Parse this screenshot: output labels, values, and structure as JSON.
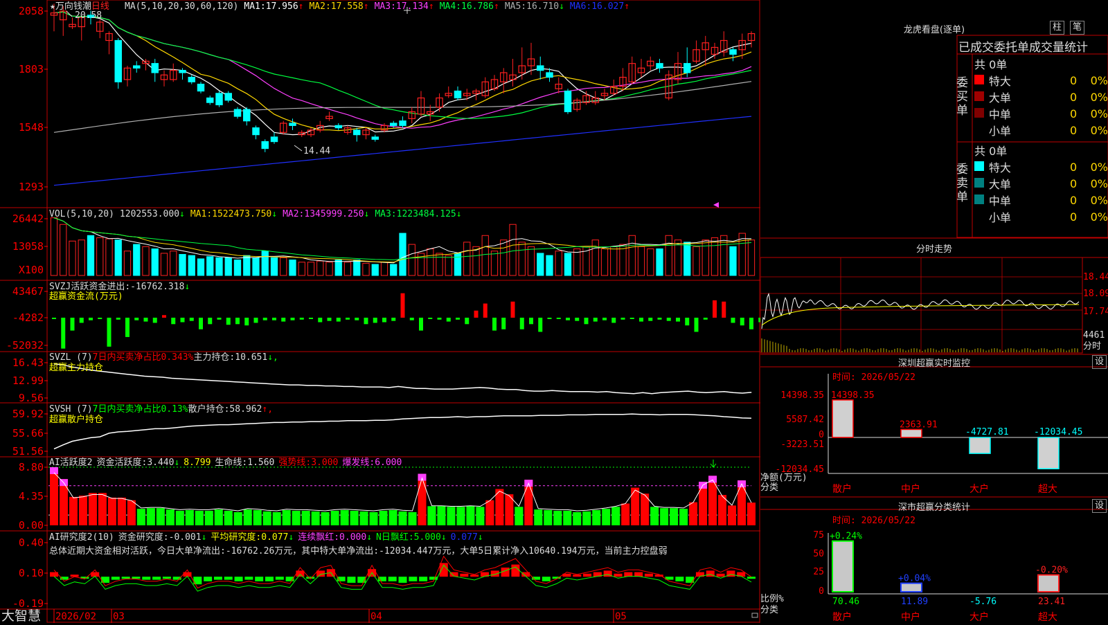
{
  "stock": {
    "name": "万向钱潮",
    "period": "日线",
    "star": "★"
  },
  "colors": {
    "up": "#ff2020",
    "down": "#00ffff",
    "ma1": "#ffffff",
    "ma2": "#ffd800",
    "ma3": "#ff40ff",
    "ma4": "#00ff40",
    "ma5": "#b0b0b0",
    "ma6": "#2030ff",
    "vol_bar": "#00ffff",
    "green": "#00ff00",
    "red": "#ff0000",
    "grid": "#c00000",
    "yellow": "#ffff00"
  },
  "price_panel": {
    "label": "MA(5,10,20,30,60,120)",
    "ma": [
      {
        "name": "MA1:",
        "value": "17.956",
        "arrow": "↑"
      },
      {
        "name": "MA2:",
        "value": "17.558",
        "arrow": "↑"
      },
      {
        "name": "MA3:",
        "value": "17.134",
        "arrow": "↑"
      },
      {
        "name": "MA4:",
        "value": "16.786",
        "arrow": "↑"
      },
      {
        "name": "MA5:",
        "value": "16.710",
        "arrow": "↓"
      },
      {
        "name": "MA6:",
        "value": "16.027",
        "arrow": "↑"
      }
    ],
    "high_mark": "20.58",
    "low_mark": "14.44",
    "ylabels": [
      "2058",
      "1803",
      "1548",
      "1293"
    ]
  },
  "vol_panel": {
    "label": "VOL(5,10,20)",
    "value": "1202553.000",
    "arrow": "↓",
    "ma": [
      {
        "name": "MA1:",
        "value": "1522473.750",
        "arrow": "↓"
      },
      {
        "name": "MA2:",
        "value": "1345999.250",
        "arrow": "↓"
      },
      {
        "name": "MA3:",
        "value": "1223484.125",
        "arrow": "↓"
      }
    ],
    "ylabels": [
      "26442",
      "13058"
    ],
    "unit": "X100"
  },
  "svzj_panel": {
    "label": "SVZJ",
    "name": "活跃资金进出:",
    "value": "-16762.318",
    "arrow": "↓",
    "sub": "超赢资金流(万元)",
    "ylabels": [
      "43467",
      "-4282",
      "-52032"
    ]
  },
  "svzl_panel": {
    "label": "SVZL (7)",
    "desc": "7日内买卖净占比0.343%",
    "name": "主力持仓:",
    "value": "10.651",
    "arrow": "↓,",
    "sub": "超赢主力持仓",
    "ylabels": [
      "16.43",
      "12.99",
      "9.56"
    ]
  },
  "svsh_panel": {
    "label": "SVSH (7)",
    "desc": "7日内买卖净占比0.13%",
    "name": "散户持仓:",
    "value": "58.962",
    "arrow": "↑,",
    "sub": "超赢散户持仓",
    "ylabels": [
      "59.92",
      "55.66",
      "51.56"
    ]
  },
  "ai1_panel": {
    "label": "AI活跃度2",
    "name": "资金活跃度:",
    "value": "3.440",
    "arrow": "↓",
    "v2": "8.799",
    "life": "生命线:",
    "life_v": "1.560",
    "strong": "强势线:",
    "strong_v": "3.000",
    "burst": "爆发线:",
    "burst_v": "6.000",
    "ylabels": [
      "8.80",
      "4.35",
      "0.00"
    ]
  },
  "ai2_panel": {
    "label": "AI研究度2(10)",
    "name": "资金研究度:",
    "value": "-0.001",
    "avg": "平均研究度:",
    "avg_v": "0.077",
    "cont": "连续飘红:",
    "cont_v": "0.000",
    "nday": "N日飘红:",
    "nday_v": "5.000",
    "last": "0.077",
    "summary": "总体近期大资金相对活跃，今日大单净流出:-16762.26万元，其中特大单净流出:-12034.447万元，大单5日累计净入10640.194万元，当前主力控盘弱",
    "ylabels": [
      "0.40",
      "0.10",
      "-0.19"
    ]
  },
  "x_axis": {
    "labels": [
      "2026/02",
      "03",
      "04",
      "05"
    ]
  },
  "footer": {
    "brand": "大智慧"
  },
  "chart_data": {
    "type": "candlestick",
    "dates_axis": [
      "2026/02",
      "03",
      "04",
      "05"
    ],
    "candles": [
      [
        20.4,
        20.5,
        19.7,
        20.9
      ],
      [
        20.2,
        20.58,
        19.5,
        20.8
      ],
      [
        19.9,
        20.0,
        19.8,
        20.3
      ],
      [
        19.9,
        20.3,
        19.3,
        20.4
      ],
      [
        20.4,
        20.3,
        20.0,
        20.6
      ],
      [
        19.7,
        20.1,
        19.4,
        20.2
      ],
      [
        19.3,
        19.6,
        18.7,
        19.7
      ],
      [
        19.3,
        17.5,
        17.2,
        19.4
      ],
      [
        17.6,
        18.1,
        17.3,
        18.2
      ],
      [
        18.2,
        18.1,
        17.9,
        18.4
      ],
      [
        18.3,
        18.4,
        18.0,
        18.5
      ],
      [
        18.3,
        17.9,
        17.5,
        18.5
      ],
      [
        17.6,
        17.8,
        17.3,
        18.0
      ],
      [
        17.6,
        18.0,
        17.5,
        18.3
      ],
      [
        18.0,
        17.9,
        17.6,
        18.1
      ],
      [
        17.7,
        17.5,
        17.4,
        17.8
      ],
      [
        17.4,
        17.1,
        17.0,
        17.5
      ],
      [
        16.8,
        16.6,
        16.5,
        16.9
      ],
      [
        17.0,
        16.5,
        16.4,
        17.1
      ],
      [
        17.0,
        16.7,
        16.6,
        17.1
      ],
      [
        16.3,
        16.0,
        15.9,
        16.4
      ],
      [
        16.3,
        15.8,
        15.6,
        16.4
      ],
      [
        15.5,
        15.2,
        15.0,
        15.6
      ],
      [
        14.9,
        14.6,
        14.44,
        15.0
      ],
      [
        15.1,
        14.9,
        14.8,
        15.3
      ],
      [
        15.3,
        15.7,
        15.2,
        15.8
      ],
      [
        15.7,
        15.6,
        15.4,
        15.9
      ],
      [
        15.2,
        15.3,
        15.1,
        15.4
      ],
      [
        15.2,
        15.4,
        15.1,
        15.5
      ],
      [
        15.4,
        15.6,
        15.3,
        15.8
      ],
      [
        15.9,
        16.0,
        15.8,
        16.2
      ],
      [
        15.6,
        15.5,
        15.4,
        15.7
      ],
      [
        15.3,
        15.5,
        15.2,
        15.6
      ],
      [
        15.4,
        15.2,
        14.9,
        15.5
      ],
      [
        15.2,
        15.4,
        15.0,
        15.5
      ],
      [
        15.1,
        15.0,
        14.9,
        15.2
      ],
      [
        15.4,
        15.6,
        15.3,
        15.7
      ],
      [
        15.7,
        15.6,
        15.5,
        15.8
      ],
      [
        15.8,
        15.6,
        15.5,
        16.0
      ],
      [
        15.9,
        16.2,
        15.7,
        16.4
      ],
      [
        16.1,
        16.8,
        16.0,
        17.1
      ],
      [
        16.1,
        16.2,
        15.8,
        16.5
      ],
      [
        16.4,
        16.8,
        16.2,
        17.0
      ],
      [
        16.9,
        17.0,
        16.8,
        17.3
      ],
      [
        17.1,
        16.8,
        16.7,
        17.3
      ],
      [
        16.9,
        17.0,
        16.7,
        17.2
      ],
      [
        17.0,
        17.1,
        16.7,
        17.2
      ],
      [
        16.9,
        17.5,
        16.8,
        17.7
      ],
      [
        17.2,
        17.6,
        17.1,
        17.8
      ],
      [
        17.5,
        17.9,
        17.0,
        18.1
      ],
      [
        17.6,
        17.8,
        17.3,
        18.5
      ],
      [
        17.9,
        18.2,
        17.6,
        19.0
      ],
      [
        18.2,
        18.5,
        17.8,
        19.2
      ],
      [
        18.2,
        18.0,
        17.6,
        18.6
      ],
      [
        17.9,
        17.7,
        17.5,
        18.1
      ],
      [
        17.2,
        17.4,
        17.0,
        17.7
      ],
      [
        17.1,
        16.2,
        16.1,
        17.2
      ],
      [
        16.3,
        16.7,
        16.2,
        16.8
      ],
      [
        16.6,
        16.9,
        16.5,
        17.1
      ],
      [
        16.6,
        16.8,
        16.5,
        17.1
      ],
      [
        16.9,
        17.0,
        16.7,
        17.2
      ],
      [
        17.0,
        17.3,
        16.9,
        17.6
      ],
      [
        17.3,
        17.7,
        17.1,
        18.1
      ],
      [
        17.5,
        18.3,
        17.4,
        18.6
      ],
      [
        17.9,
        18.1,
        17.7,
        18.5
      ],
      [
        18.2,
        18.4,
        18.0,
        18.6
      ],
      [
        18.3,
        18.1,
        17.9,
        18.5
      ],
      [
        16.8,
        17.8,
        16.7,
        18.0
      ],
      [
        17.6,
        18.3,
        17.4,
        18.8
      ],
      [
        18.3,
        17.9,
        17.7,
        19.0
      ],
      [
        18.4,
        18.9,
        18.3,
        19.3
      ],
      [
        18.9,
        19.2,
        18.2,
        19.5
      ],
      [
        18.7,
        19.0,
        18.5,
        19.2
      ],
      [
        18.8,
        19.3,
        18.6,
        19.7
      ],
      [
        18.9,
        18.7,
        18.4,
        19.0
      ],
      [
        18.9,
        19.3,
        18.5,
        19.6
      ],
      [
        19.3,
        19.6,
        19.0,
        19.7
      ]
    ],
    "vol": [
      2.6,
      2.3,
      1.55,
      1.6,
      1.8,
      1.7,
      1.65,
      1.6,
      1.1,
      1.4,
      1.3,
      1.2,
      1.0,
      1.1,
      0.95,
      0.9,
      0.75,
      0.85,
      0.8,
      0.8,
      0.7,
      0.9,
      0.8,
      1.1,
      0.8,
      0.8,
      0.7,
      0.6,
      0.6,
      0.65,
      0.6,
      0.7,
      0.6,
      0.7,
      0.55,
      0.5,
      0.6,
      0.5,
      1.9,
      1.4,
      1.0,
      1.2,
      1.0,
      0.9,
      1.0,
      1.5,
      1.3,
      1.8,
      1.1,
      1.6,
      2.3,
      1.5,
      1.3,
      1.0,
      0.9,
      1.1,
      1.0,
      1.2,
      1.3,
      1.6,
      1.2,
      1.3,
      1.4,
      1.8,
      1.3,
      1.2,
      1.2,
      1.8,
      1.6,
      1.5,
      1.3,
      1.6,
      1.7,
      1.8,
      1.3,
      1.9,
      1.6
    ],
    "svzj": [
      -2,
      -48,
      -20,
      -8,
      -4,
      -1,
      -45,
      -3,
      -30,
      -4,
      -6,
      -8,
      4,
      -10,
      -7,
      -5,
      -18,
      -10,
      -3,
      -11,
      -10,
      -12,
      -8,
      -4,
      -4,
      -6,
      -4,
      -3,
      -2,
      -7,
      -5,
      -6,
      -3,
      -4,
      -10,
      -8,
      -7,
      -5,
      38,
      -4,
      -20,
      -2,
      -3,
      -6,
      -3,
      -10,
      11,
      22,
      -20,
      -18,
      25,
      -18,
      -10,
      -22,
      -2,
      -2,
      -4,
      -5,
      -10,
      -6,
      -4,
      -8,
      -3,
      -2,
      -6,
      -5,
      -3,
      -5,
      -6,
      -12,
      -22,
      -3,
      27,
      25,
      -8,
      -12,
      -18,
      -7
    ],
    "svzl": [
      16.2,
      16.0,
      15.6,
      15.3,
      15.0,
      14.8,
      14.6,
      14.4,
      14.2,
      14.0,
      13.8,
      13.7,
      13.6,
      13.4,
      13.3,
      13.2,
      13.1,
      13.0,
      12.9,
      12.8,
      12.7,
      12.6,
      12.5,
      12.4,
      12.3,
      12.2,
      12.1,
      12.1,
      12.0,
      12.0,
      11.9,
      11.9,
      11.8,
      11.8,
      11.7,
      11.7,
      11.7,
      11.6,
      11.8,
      11.6,
      11.4,
      11.4,
      11.3,
      11.3,
      11.3,
      11.4,
      11.5,
      11.6,
      11.5,
      11.3,
      11.2,
      11.2,
      11.0,
      10.9,
      10.9,
      11.0,
      10.9,
      10.8,
      10.8,
      10.8,
      10.7,
      10.8,
      10.6,
      10.5,
      10.4,
      10.6,
      10.4,
      10.6,
      10.7,
      10.8,
      10.9,
      10.7,
      10.6,
      10.7,
      10.8,
      10.6,
      10.5,
      10.651
    ],
    "svsh": [
      52.1,
      53.0,
      53.8,
      54.2,
      54.6,
      54.8,
      55.6,
      55.9,
      56.0,
      56.2,
      56.4,
      56.6,
      56.6,
      56.8,
      57.0,
      57.2,
      57.3,
      57.4,
      57.5,
      57.5,
      57.6,
      57.7,
      57.8,
      57.9,
      58.0,
      58.0,
      58.1,
      58.1,
      58.2,
      58.2,
      58.3,
      58.3,
      58.4,
      58.4,
      58.4,
      58.5,
      58.5,
      58.6,
      58.8,
      58.9,
      59.0,
      59.1,
      59.1,
      59.2,
      59.3,
      59.2,
      59.3,
      59.3,
      59.4,
      59.5,
      59.5,
      59.5,
      59.5,
      59.6,
      59.6,
      59.6,
      59.7,
      59.7,
      59.7,
      59.8,
      59.8,
      59.8,
      59.8,
      59.9,
      59.8,
      59.8,
      59.7,
      59.8,
      59.8,
      59.8,
      59.7,
      59.6,
      59.5,
      59.3,
      59.2,
      59.0,
      58.962
    ],
    "ai_act": [
      8.8,
      7.0,
      4.3,
      4.5,
      4.9,
      4.9,
      4.2,
      4.2,
      3.8,
      2.5,
      2.6,
      2.6,
      2.4,
      2.2,
      2.3,
      2.2,
      2.2,
      2.4,
      2.2,
      2.0,
      2.4,
      2.3,
      2.1,
      2.0,
      2.3,
      2.2,
      2.2,
      2.1,
      2.0,
      2.2,
      2.3,
      2.2,
      2.1,
      2.0,
      2.2,
      2.3,
      2.1,
      2.0,
      7.8,
      2.9,
      2.9,
      2.8,
      2.8,
      2.9,
      2.8,
      3.8,
      5.5,
      4.7,
      2.8,
      6.9,
      2.4,
      2.3,
      2.2,
      2.2,
      2.0,
      2.1,
      2.3,
      2.5,
      2.8,
      3.3,
      5.7,
      4.8,
      2.8,
      2.6,
      2.6,
      2.5,
      3.5,
      6.6,
      7.5,
      4.6,
      3.0,
      6.8,
      3.44
    ],
    "ai_res": [
      0.03,
      -0.02,
      0.0,
      -0.01,
      0.03,
      -0.04,
      -0.02,
      -0.01,
      -0.01,
      -0.02,
      -0.02,
      -0.01,
      -0.02,
      0.03,
      -0.05,
      -0.03,
      -0.02,
      -0.02,
      -0.03,
      -0.02,
      -0.03,
      -0.03,
      -0.02,
      -0.03,
      0.04,
      -0.01,
      0.04,
      0.05,
      -0.03,
      -0.04,
      -0.04,
      0.05,
      -0.03,
      -0.03,
      -0.04,
      -0.03,
      -0.03,
      -0.02,
      0.09,
      0.03,
      0.02,
      0.01,
      0.03,
      0.04,
      0.06,
      0.08,
      0.03,
      -0.02,
      -0.03,
      -0.01,
      0.02,
      0.01,
      0.02,
      0.03,
      0.04,
      0.02,
      0.03,
      0.03,
      0.02,
      0.01,
      -0.02,
      -0.03,
      -0.04,
      0.03,
      0.04,
      0.02,
      0.04,
      0.03,
      -0.001
    ]
  },
  "right": {
    "lhb": {
      "title": "龙虎看盘(逐单)",
      "btn1": "柱",
      "btn2": "笔",
      "header": "已成交委托单成交量统计",
      "buy": {
        "label": "委买单",
        "total": "共 0单",
        "rows": [
          {
            "name": "特大",
            "vol": "0",
            "pct": "0%",
            "color": "#ff0000"
          },
          {
            "name": "大单",
            "vol": "0",
            "pct": "0%",
            "color": "#a00000"
          },
          {
            "name": "中单",
            "vol": "0",
            "pct": "0%",
            "color": "#800000"
          },
          {
            "name": "小单",
            "vol": "0",
            "pct": "0%",
            "color": ""
          }
        ]
      },
      "sell": {
        "label": "委卖单",
        "total": "共 0单",
        "rows": [
          {
            "name": "特大",
            "vol": "0",
            "pct": "0%",
            "color": "#00ffff"
          },
          {
            "name": "大单",
            "vol": "0",
            "pct": "0%",
            "color": "#008080"
          },
          {
            "name": "中单",
            "vol": "0",
            "pct": "0%",
            "color": "#008080"
          },
          {
            "name": "小单",
            "vol": "0",
            "pct": "0%",
            "color": ""
          }
        ]
      }
    },
    "intraday": {
      "title": "分时走势",
      "labels": [
        "18.44",
        "18.09",
        "17.74"
      ],
      "vol_label": "4461",
      "vol_unit": "分时",
      "avg_color": "#ffff00"
    },
    "monitor": {
      "title": "深圳超赢实时监控",
      "btn": "设",
      "time": "时间: 2026/05/22",
      "ylabels": [
        "14398.35",
        "5587.42",
        "0",
        "-3223.51",
        "-12034.45"
      ],
      "unit": "净额(万元)",
      "cls": "分类",
      "bars": [
        {
          "cat": "散户",
          "value": "14398.35",
          "n": 14398.35
        },
        {
          "cat": "中户",
          "value": "2363.91",
          "n": 2363.91
        },
        {
          "cat": "大户",
          "value": "-4727.81",
          "n": -4727.81
        },
        {
          "cat": "超大",
          "value": "-12034.45",
          "n": -12034.45
        }
      ]
    },
    "classify": {
      "title": "深市超赢分类统计",
      "btn": "设",
      "time": "时间: 2026/05/22",
      "ylabels": [
        "75",
        "50",
        "25",
        "0"
      ],
      "unit": "比例%",
      "cls": "分类",
      "bars": [
        {
          "cat": "散户",
          "top": "+0.24%",
          "value": "70.46",
          "n": 70.46,
          "color": "#00ff00",
          "vcolor": "#00ff00"
        },
        {
          "cat": "中户",
          "top": "+0.04%",
          "value": "11.89",
          "n": 11.89,
          "color": "#2040ff",
          "vcolor": "#2040ff"
        },
        {
          "cat": "大户",
          "top": "",
          "value": "-5.76",
          "n": 0,
          "color": "#00ffff",
          "vcolor": "#00ffff"
        },
        {
          "cat": "超大",
          "top": "-0.20%",
          "value": "23.41",
          "n": 23.41,
          "color": "#ff2020",
          "vcolor": "#ff2020"
        }
      ]
    }
  }
}
